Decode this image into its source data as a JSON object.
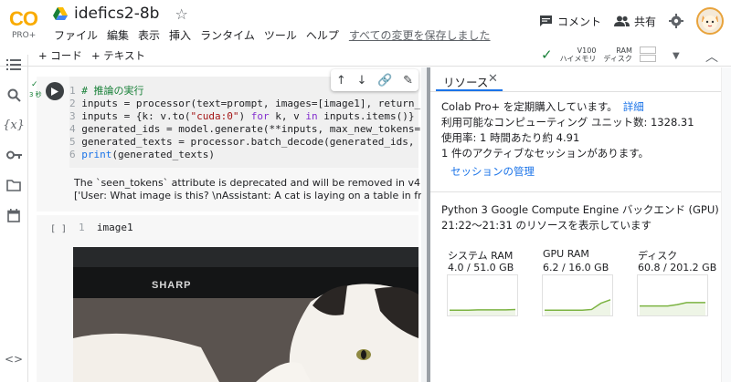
{
  "header": {
    "logo_text": "CO",
    "logo_sub": "PRO+",
    "notebook_title": "idefics2-8b",
    "comment_label": "コメント",
    "share_label": "共有"
  },
  "menu": {
    "items": [
      "ファイル",
      "編集",
      "表示",
      "挿入",
      "ランタイム",
      "ツール",
      "ヘルプ"
    ],
    "saved_status": "すべての変更を保存しました"
  },
  "toolbar": {
    "add_code": "+ コード",
    "add_text": "+ テキスト",
    "runtime_type": "V100",
    "runtime_mode": "ハイメモリ",
    "ram_label": "RAM",
    "disk_label": "ディスク"
  },
  "cell1": {
    "exec_time": "3 秒",
    "code": [
      {
        "n": "1",
        "parts": [
          {
            "t": "# 推論の実行",
            "c": "cm"
          }
        ]
      },
      {
        "n": "2",
        "parts": [
          {
            "t": "inputs = processor(text=prompt, images=[image1], return_",
            "c": ""
          }
        ]
      },
      {
        "n": "3",
        "parts": [
          {
            "t": "inputs = {k: v.to(",
            "c": ""
          },
          {
            "t": "\"cuda:0\"",
            "c": "st"
          },
          {
            "t": ") ",
            "c": ""
          },
          {
            "t": "for",
            "c": "kw"
          },
          {
            "t": " k, v ",
            "c": ""
          },
          {
            "t": "in",
            "c": "kw"
          },
          {
            "t": " inputs.items()}",
            "c": ""
          }
        ]
      },
      {
        "n": "4",
        "parts": [
          {
            "t": "generated_ids = model.generate(**inputs, max_new_tokens=",
            "c": ""
          }
        ]
      },
      {
        "n": "5",
        "parts": [
          {
            "t": "generated_texts = processor.batch_decode(generated_ids, ",
            "c": ""
          }
        ]
      },
      {
        "n": "6",
        "parts": [
          {
            "t": "print",
            "c": "nm"
          },
          {
            "t": "(generated_texts)",
            "c": ""
          }
        ]
      }
    ],
    "output": [
      "The `seen_tokens` attribute is deprecated and will be removed in v4.41",
      "['User: What image is this? \\nAssistant: A cat is laying on a table in front"
    ]
  },
  "cell2": {
    "bracket": "[ ]",
    "line_no": "1",
    "code": "image1",
    "tv_brand": "SHARP"
  },
  "panel": {
    "tab_label": "リソース",
    "subscription_prefix": "Colab Pro+ を定期購入しています。",
    "details_link": "詳細",
    "units": "利用可能なコンピューティング ユニット数: 1328.31",
    "usage": "使用率: 1 時間あたり約 4.91",
    "sessions": "1 件のアクティブなセッションがあります。",
    "manage_sessions": "セッションの管理",
    "backend": "Python 3 Google Compute Engine バックエンド (GPU)",
    "time_range": "21:22〜21:31 のリソースを表示しています",
    "gauges": [
      {
        "label": "システム RAM",
        "value": "4.0 / 51.0 GB",
        "points": [
          0.1,
          0.1,
          0.1,
          0.11,
          0.11,
          0.11,
          0.11,
          0.12
        ]
      },
      {
        "label": "GPU RAM",
        "value": "6.2 / 16.0 GB",
        "points": [
          0.1,
          0.1,
          0.1,
          0.1,
          0.1,
          0.12,
          0.3,
          0.4
        ]
      },
      {
        "label": "ディスク",
        "value": "60.8 / 201.2 GB",
        "points": [
          0.22,
          0.22,
          0.22,
          0.22,
          0.26,
          0.32,
          0.32,
          0.32
        ]
      }
    ]
  },
  "colors": {
    "accent": "#1a73e8",
    "logo": "#f9ab00",
    "ok_green": "#188038",
    "gauge_line": "#7cb342"
  }
}
